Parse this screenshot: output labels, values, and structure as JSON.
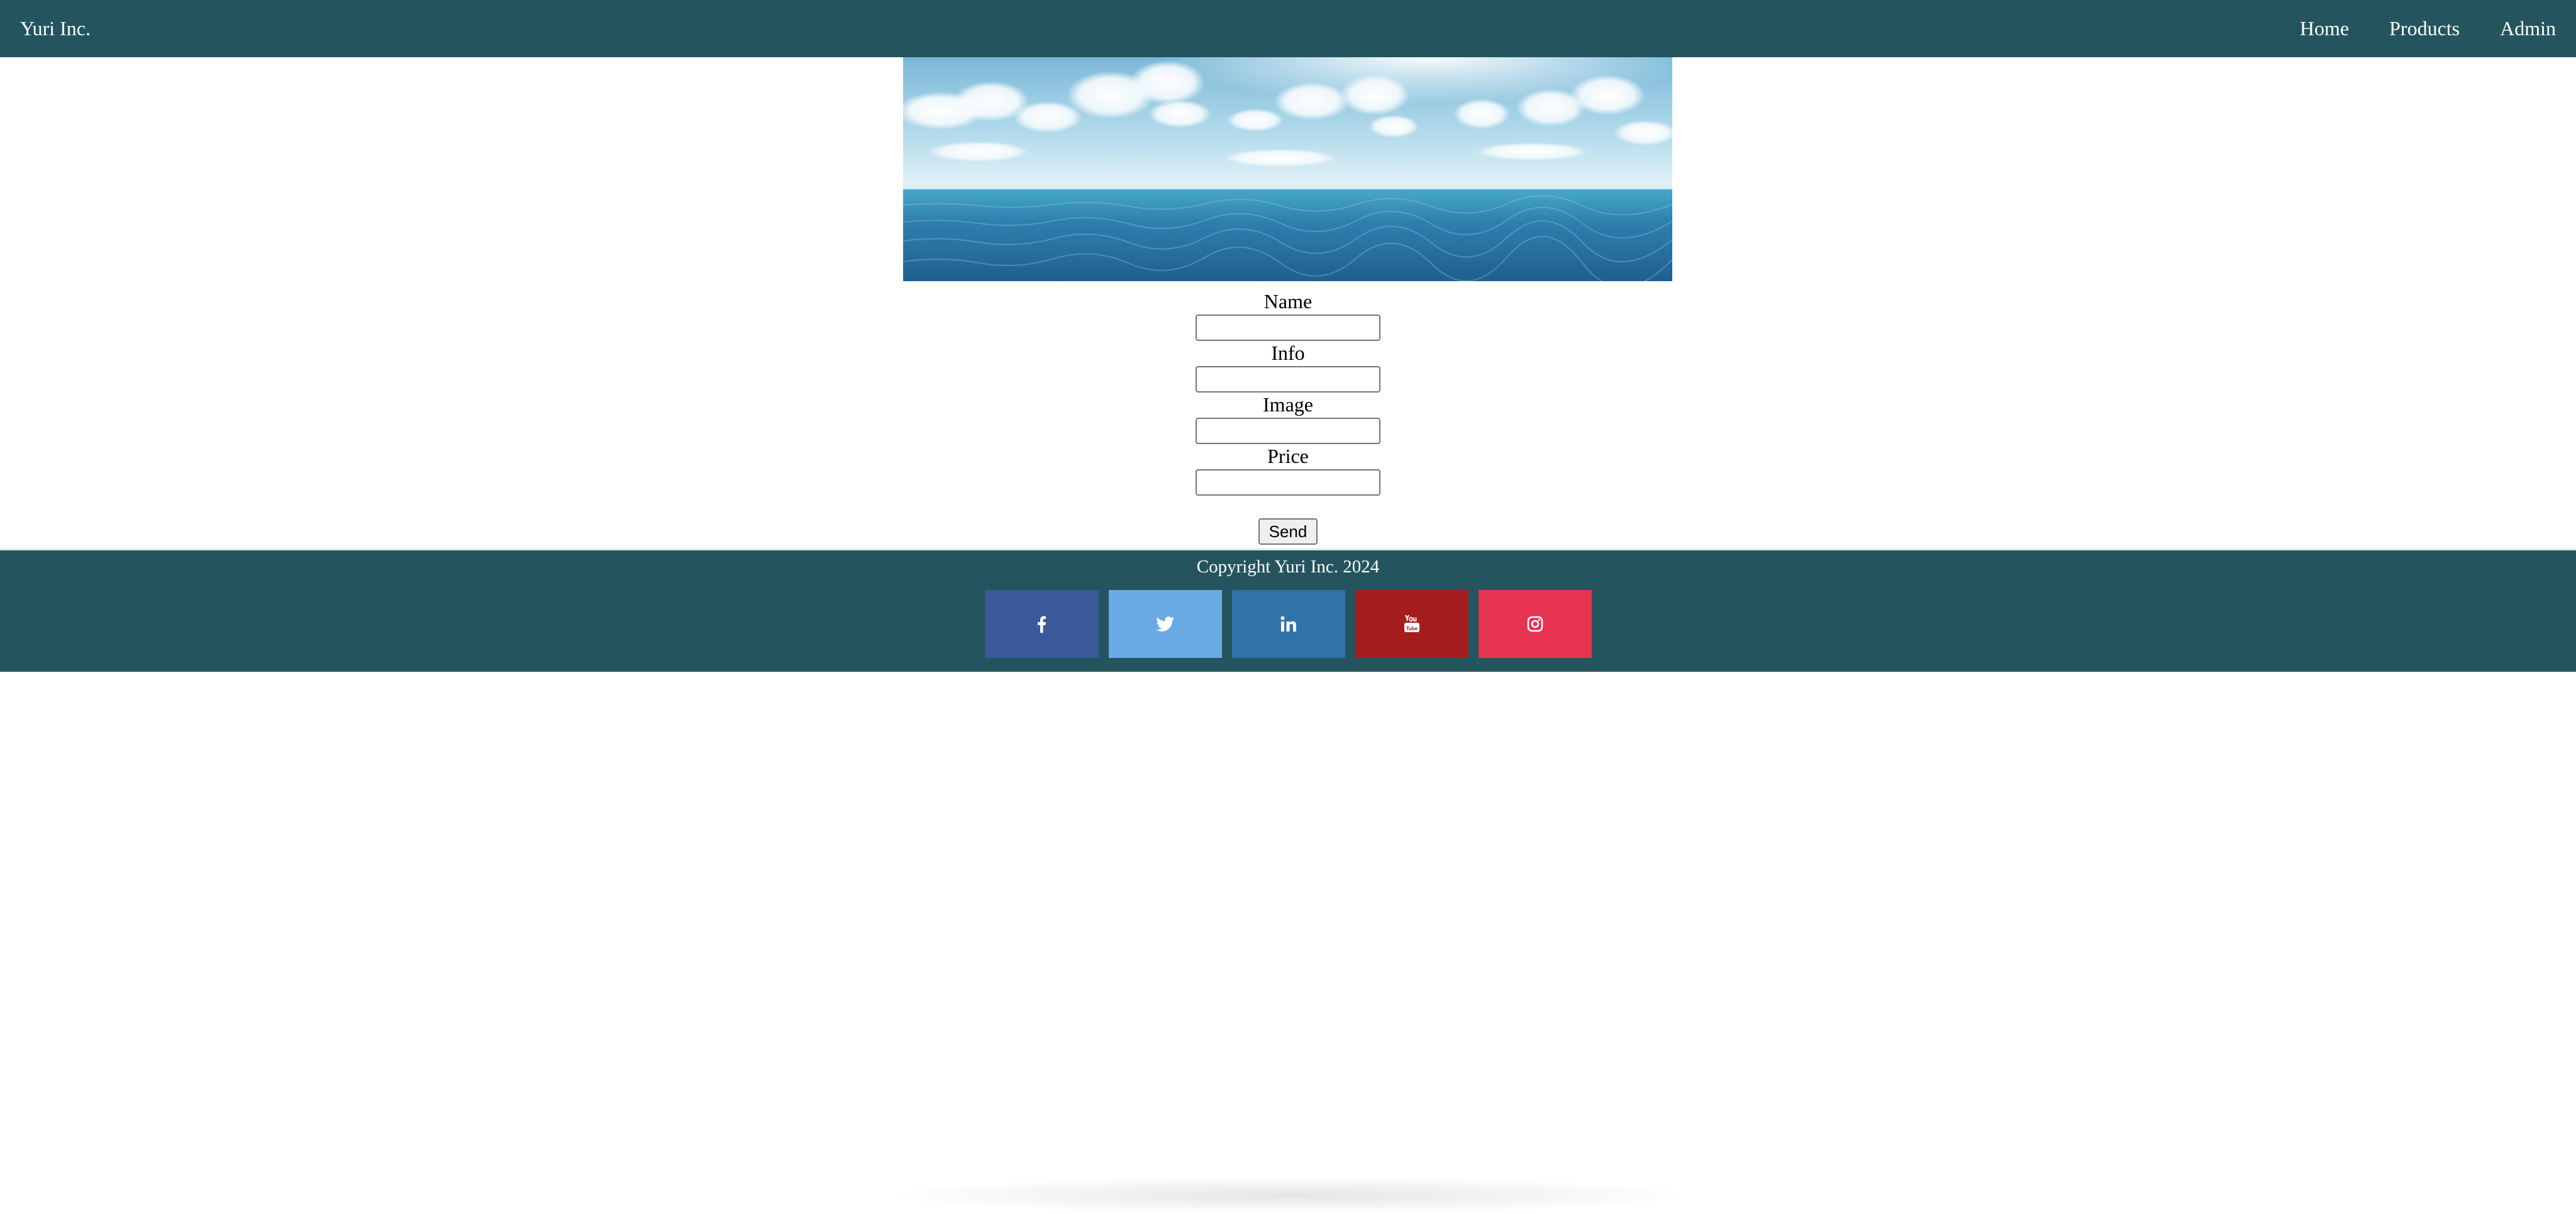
{
  "navbar": {
    "brand": "Yuri Inc.",
    "links": [
      {
        "label": "Home"
      },
      {
        "label": "Products"
      },
      {
        "label": "Admin"
      }
    ],
    "background": "#24555e"
  },
  "hero": {
    "icon": "ocean-banner-image"
  },
  "form": {
    "fields": [
      {
        "label": "Name",
        "value": ""
      },
      {
        "label": "Info",
        "value": ""
      },
      {
        "label": "Image",
        "value": ""
      },
      {
        "label": "Price",
        "value": ""
      }
    ],
    "submit_label": "Send"
  },
  "footer": {
    "copyright": "Copyright Yuri Inc. 2024",
    "social": [
      {
        "icon": "facebook-icon",
        "color": "#3b5998"
      },
      {
        "icon": "twitter-icon",
        "color": "#55acee"
      },
      {
        "icon": "linkedin-icon",
        "color": "#2f73a8"
      },
      {
        "icon": "youtube-icon",
        "color": "#a51c1c"
      },
      {
        "icon": "instagram-icon",
        "color": "#e63350"
      }
    ]
  }
}
